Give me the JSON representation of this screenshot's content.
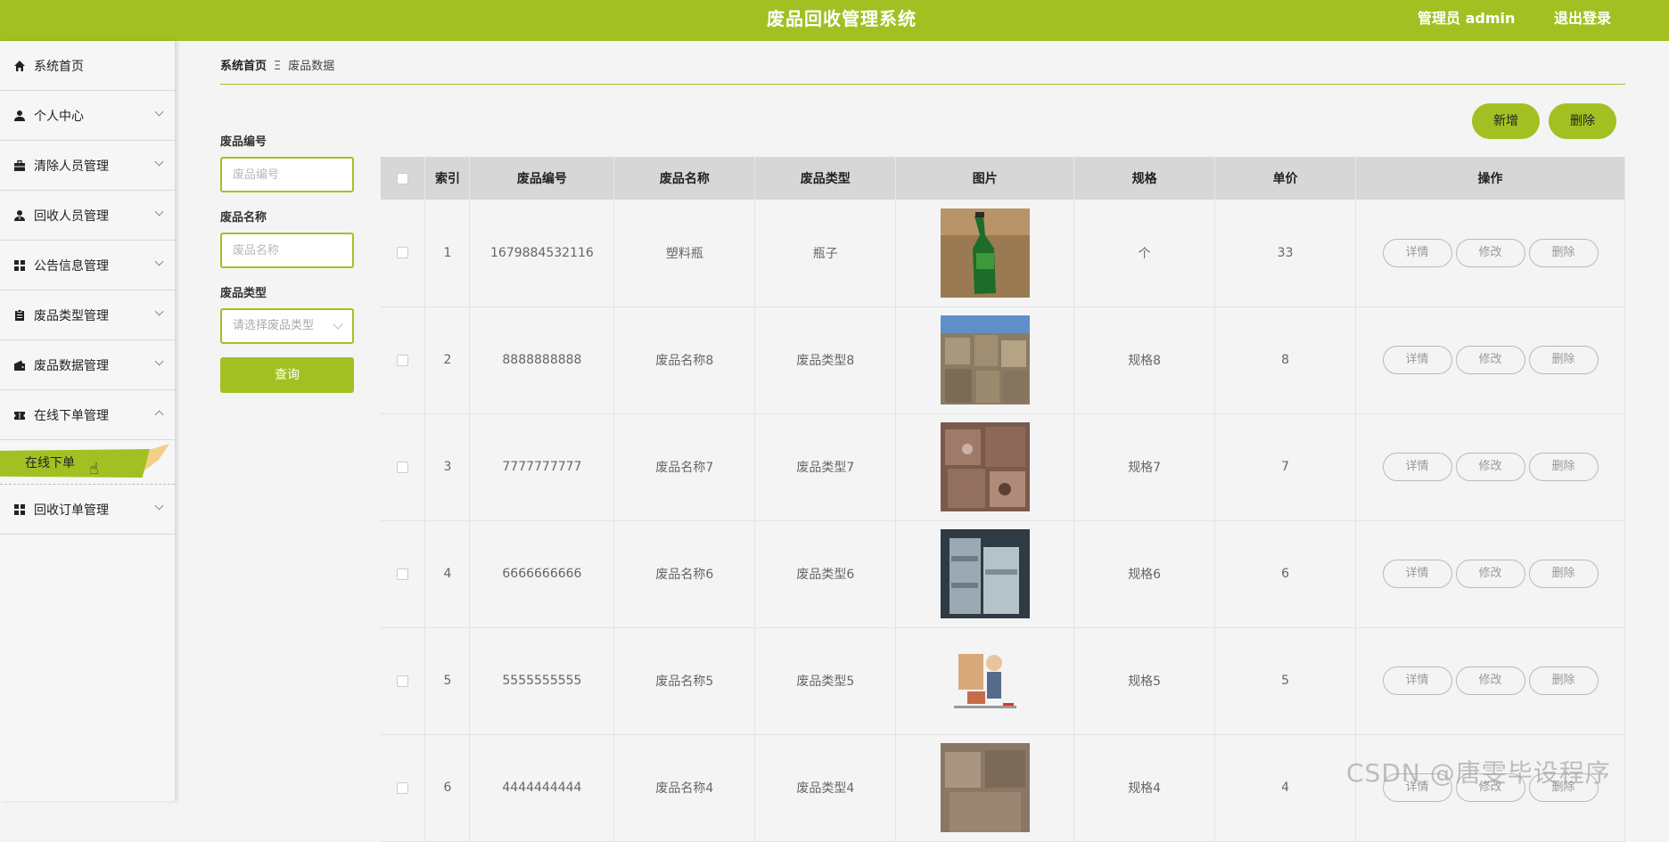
{
  "header": {
    "title": "废品回收管理系统",
    "user": "管理员 admin",
    "logout": "退出登录"
  },
  "sidebar": {
    "items": [
      {
        "label": "系统首页",
        "icon": "home-icon",
        "chevron": ""
      },
      {
        "label": "个人中心",
        "icon": "user-icon",
        "chevron": "down"
      },
      {
        "label": "清除人员管理",
        "icon": "briefcase-icon",
        "chevron": "down"
      },
      {
        "label": "回收人员管理",
        "icon": "user-badge-icon",
        "chevron": "down"
      },
      {
        "label": "公告信息管理",
        "icon": "grid-icon",
        "chevron": "down"
      },
      {
        "label": "废品类型管理",
        "icon": "clipboard-icon",
        "chevron": "down"
      },
      {
        "label": "废品数据管理",
        "icon": "wallet-icon",
        "chevron": "down"
      },
      {
        "label": "在线下单管理",
        "icon": "ticket-icon",
        "chevron": "up"
      }
    ],
    "sub_item": "在线下单",
    "last_item": {
      "label": "回收订单管理",
      "icon": "grid-icon"
    }
  },
  "breadcrumb": {
    "home": "系统首页",
    "separator": "Ξ",
    "current": "废品数据"
  },
  "search": {
    "code_label": "废品编号",
    "code_placeholder": "废品编号",
    "name_label": "废品名称",
    "name_placeholder": "废品名称",
    "type_label": "废品类型",
    "type_placeholder": "请选择废品类型",
    "query_button": "查询"
  },
  "actions": {
    "add": "新增",
    "delete": "删除"
  },
  "table": {
    "headers": [
      "索引",
      "废品编号",
      "废品名称",
      "废品类型",
      "图片",
      "规格",
      "单价",
      "操作"
    ],
    "op_labels": {
      "detail": "详情",
      "edit": "修改",
      "delete": "删除"
    },
    "rows": [
      {
        "index": "1",
        "code": "1679884532116",
        "name": "塑料瓶",
        "type": "瓶子",
        "spec": "个",
        "price": "33",
        "image": "green-bottle"
      },
      {
        "index": "2",
        "code": "8888888888",
        "name": "废品名称8",
        "type": "废品类型8",
        "spec": "规格8",
        "price": "8",
        "image": "cardboard-bales"
      },
      {
        "index": "3",
        "code": "7777777777",
        "name": "废品名称7",
        "type": "废品类型7",
        "spec": "规格7",
        "price": "7",
        "image": "scrap-pile"
      },
      {
        "index": "4",
        "code": "6666666666",
        "name": "废品名称6",
        "type": "废品类型6",
        "spec": "规格6",
        "price": "6",
        "image": "paper-bales"
      },
      {
        "index": "5",
        "code": "5555555555",
        "name": "废品名称5",
        "type": "废品类型5",
        "spec": "规格5",
        "price": "5",
        "image": "cartoon-collector"
      },
      {
        "index": "6",
        "code": "4444444444",
        "name": "废品名称4",
        "type": "废品类型4",
        "spec": "规格4",
        "price": "4",
        "image": "scrap-pile-2"
      }
    ]
  },
  "watermark": "CSDN @唐雯毕设程序",
  "colors": {
    "accent": "#a3c023",
    "header_bg": "#a3c023",
    "table_header": "#d7d7d7"
  }
}
